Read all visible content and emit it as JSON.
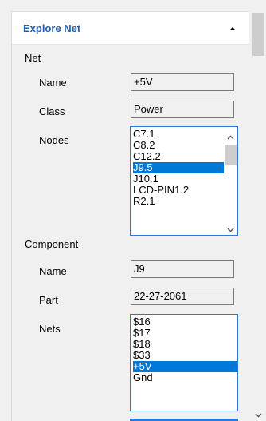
{
  "panel": {
    "title": "Explore Net"
  },
  "net": {
    "section_label": "Net",
    "name_label": "Name",
    "name_value": "+5V",
    "class_label": "Class",
    "class_value": "Power",
    "nodes_label": "Nodes",
    "nodes": [
      "C7.1",
      "C8.2",
      "C12.2",
      "J9.5",
      "J10.1",
      "LCD-PIN1.2",
      "R2.1"
    ],
    "selected_node": "J9.5"
  },
  "component": {
    "section_label": "Component",
    "name_label": "Name",
    "name_value": "J9",
    "part_label": "Part",
    "part_value": "22-27-2061",
    "nets_label": "Nets",
    "nets": [
      "$16",
      "$17",
      "$18",
      "$33",
      "+5V",
      "Gnd"
    ],
    "selected_net": "+5V"
  },
  "colors": {
    "title_blue": "#1f5fb5",
    "selection_blue": "#0078d7",
    "listbox_border": "#2b79d8"
  }
}
